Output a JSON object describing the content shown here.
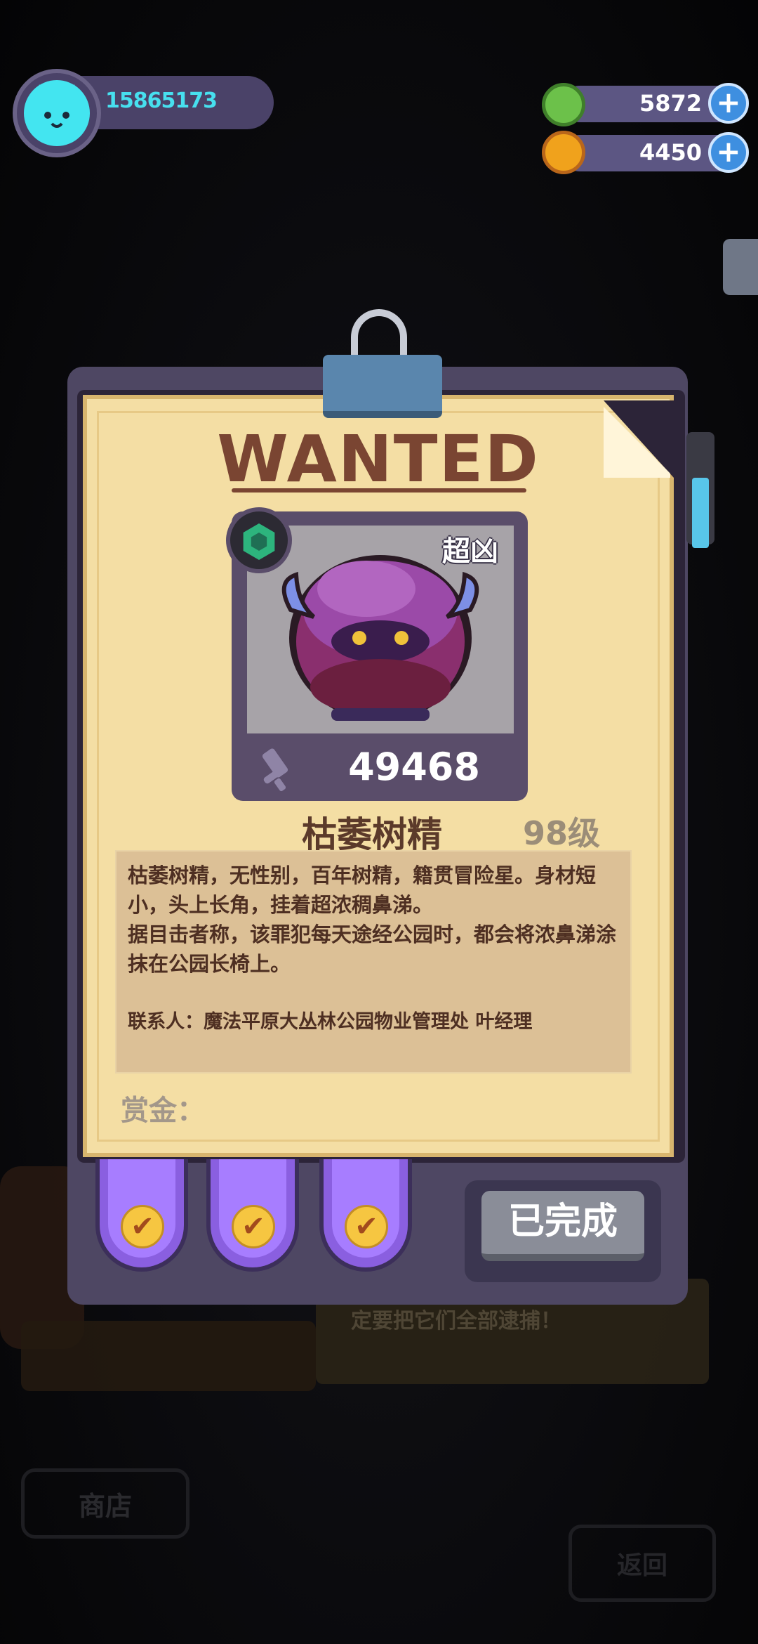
{
  "hud": {
    "player_id": "15865173",
    "currencies": [
      {
        "icon": "green-coin-icon",
        "value": "5872"
      },
      {
        "icon": "gold-planet-coin-icon",
        "value": "4450"
      }
    ],
    "plus": "+"
  },
  "poster": {
    "title": "WANTED",
    "tier": "超凶",
    "power": "49468",
    "name": "枯萎树精",
    "level": "98级",
    "description": "枯萎树精，无性别，百年树精，籍贯冒险星。身材短小，头上长角，挂着超浓稠鼻涕。\n据目击者称，该罪犯每天途经公园时，都会将浓鼻涕涂抹在公园长椅上。",
    "contact": "联系人：魔法平原大丛林公园物业管理处 叶经理",
    "reward_label": "赏金："
  },
  "rewards": [
    {
      "icon": "check-icon",
      "mark": "✔"
    },
    {
      "icon": "check-icon",
      "mark": "✔"
    },
    {
      "icon": "check-icon",
      "mark": "✔"
    }
  ],
  "action": {
    "done_label": "已完成"
  },
  "background": {
    "banner_text": "定要把它们全部逮捕！",
    "shop_label": "商店",
    "back_label": "返回"
  },
  "colors": {
    "accent_cyan": "#47e0ef",
    "paper": "#f4dea4",
    "ink": "#7a4532",
    "ribbon": "#a77dff"
  }
}
